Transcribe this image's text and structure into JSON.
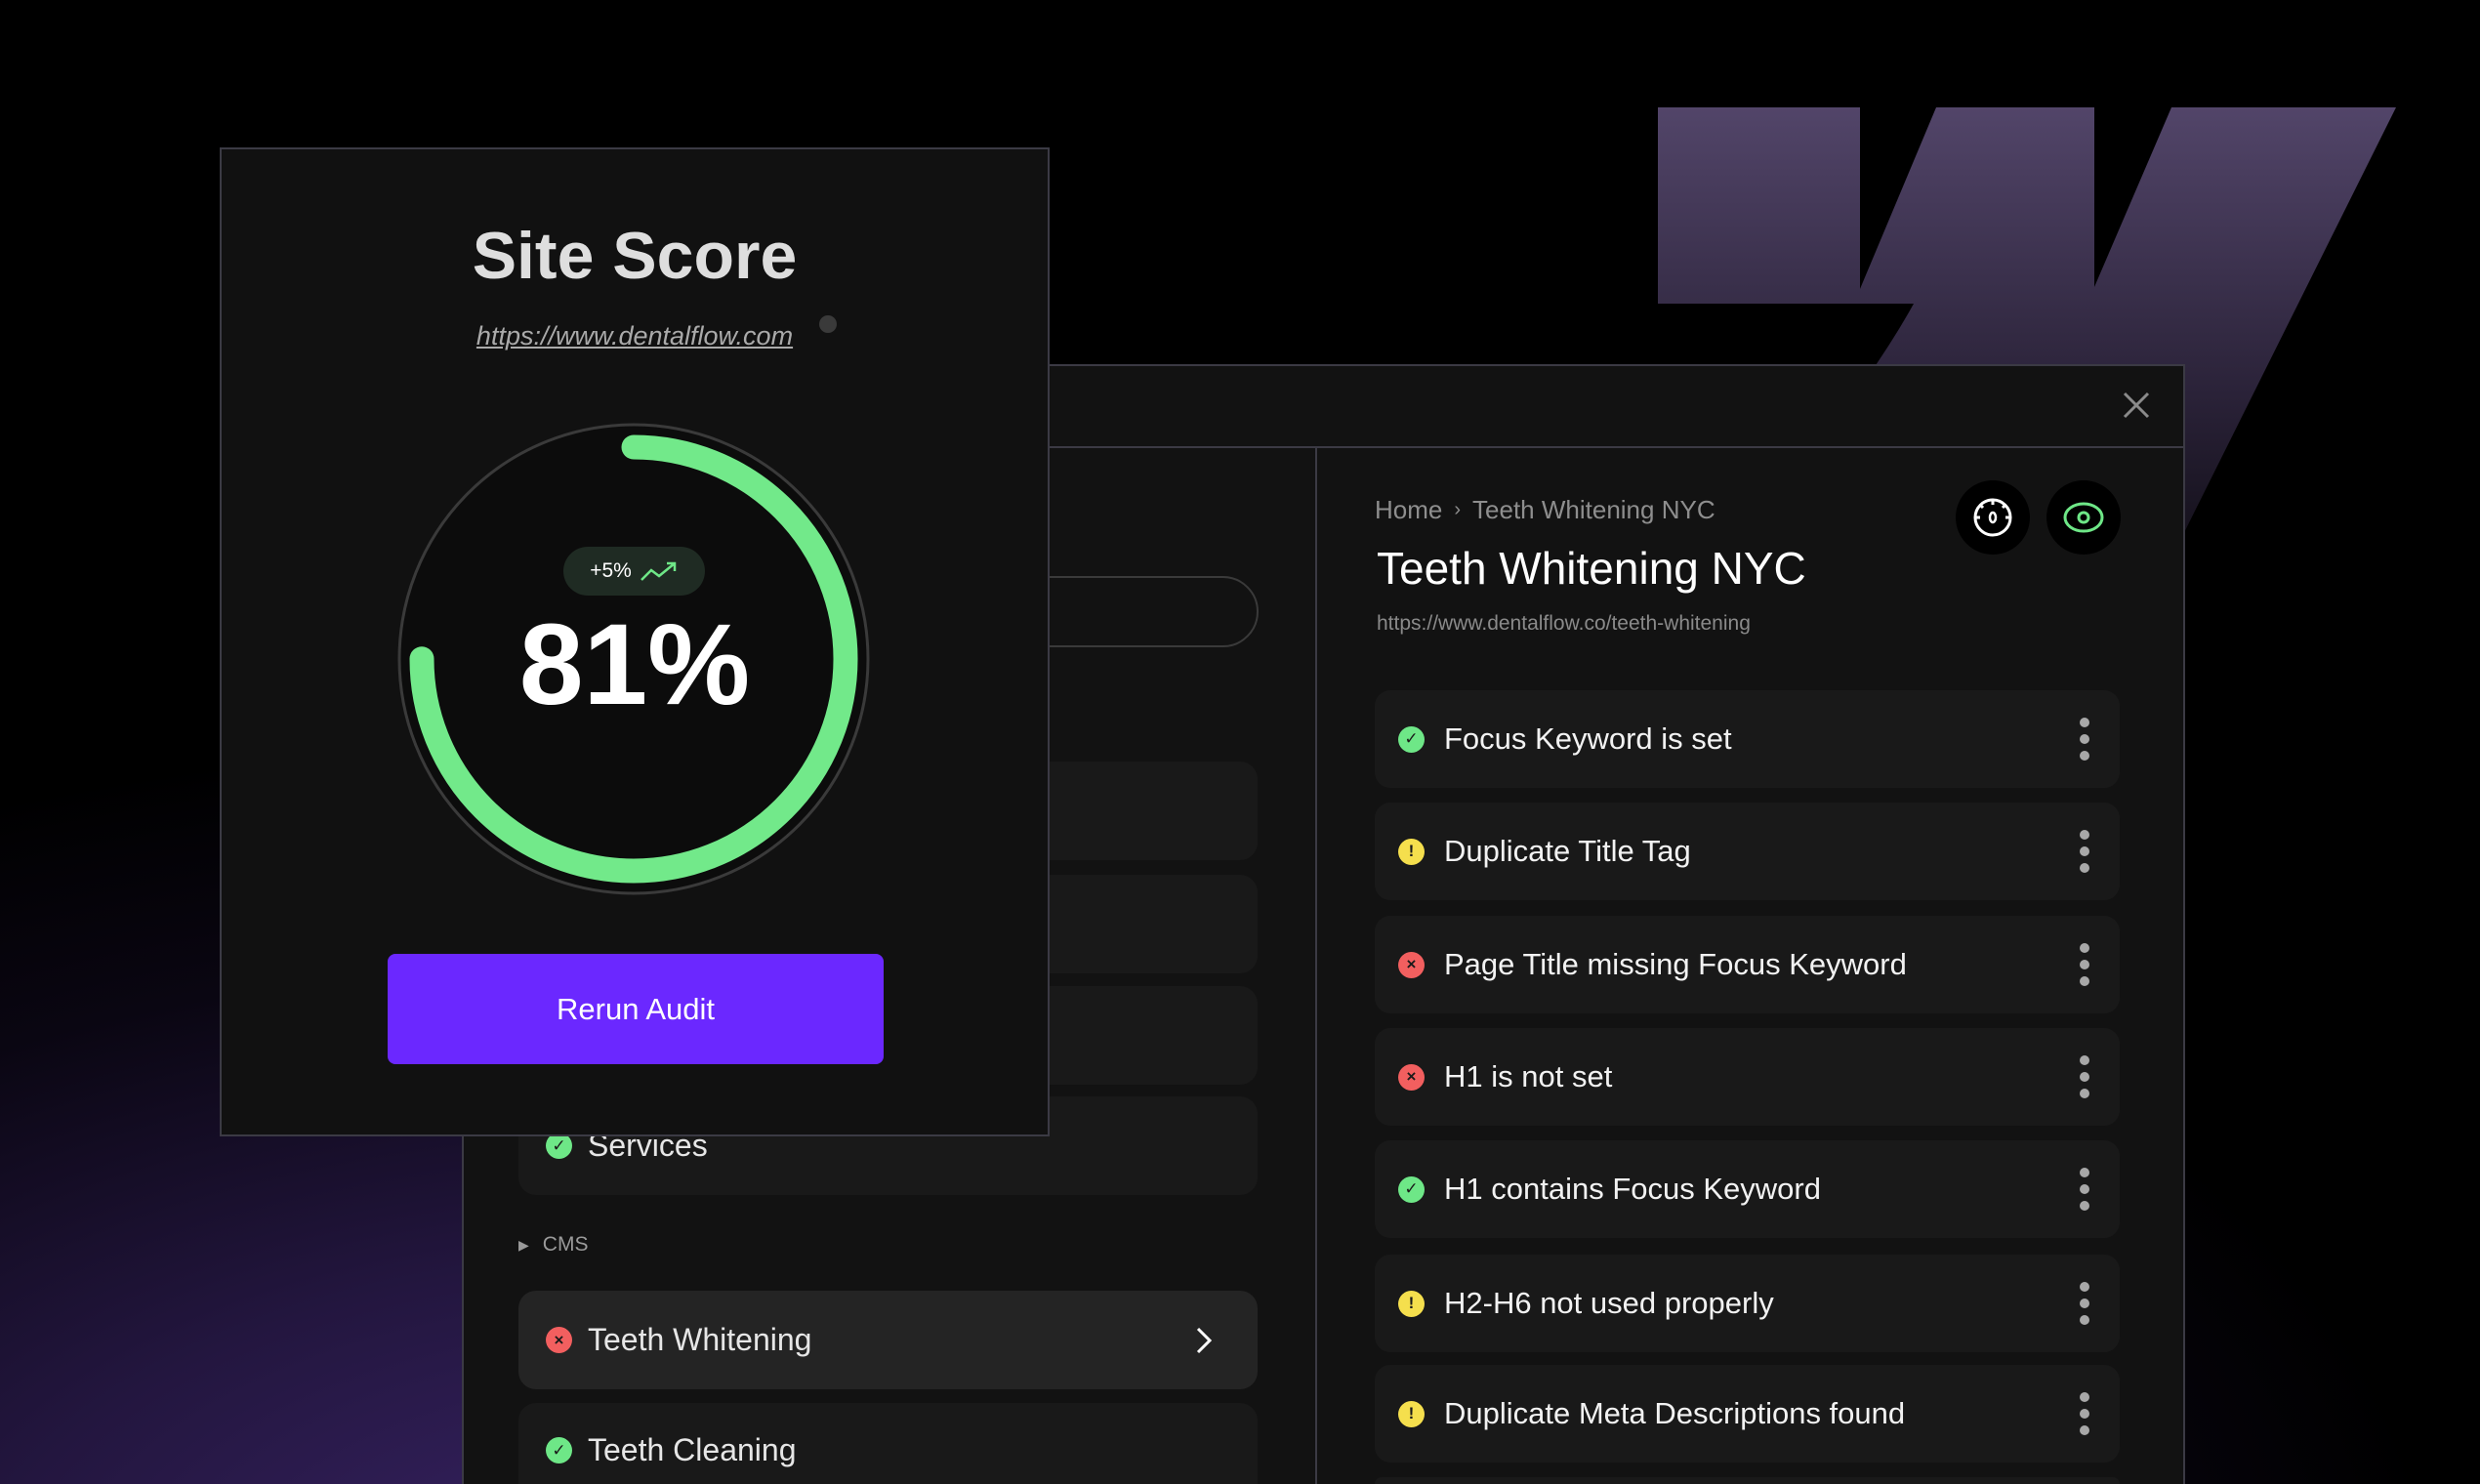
{
  "colors": {
    "accent": "#6b28ff",
    "pass": "#6ee787",
    "warning": "#f5df4d",
    "fail": "#f25f5f",
    "gauge": "#72e98a"
  },
  "logo": {
    "brand": "Webflow"
  },
  "score_card": {
    "title": "Site Score",
    "url": "https://www.dentalflow.com",
    "score_label": "81%",
    "score": 81,
    "gauge_fill_fraction": 0.75,
    "change_label": "+5%",
    "change_icon": "trend-up-icon",
    "button_label": "Rerun Audit"
  },
  "left_panel": {
    "pages": [
      {
        "label": "Services",
        "status": "pass"
      }
    ],
    "section_label": "CMS",
    "cms_items": [
      {
        "label": "Teeth Whitening",
        "status": "fail",
        "active": true
      },
      {
        "label": "Teeth Cleaning",
        "status": "pass",
        "active": false
      }
    ]
  },
  "detail": {
    "breadcrumb": [
      "Home",
      "Teeth Whitening NYC"
    ],
    "title": "Teeth Whitening NYC",
    "url": "https://www.dentalflow.co/teeth-whitening",
    "actions": [
      "speedometer-icon",
      "eye-icon"
    ],
    "issues": [
      {
        "label": "Focus Keyword is set",
        "status": "pass"
      },
      {
        "label": "Duplicate Title Tag",
        "status": "warn"
      },
      {
        "label": "Page Title missing Focus Keyword",
        "status": "fail"
      },
      {
        "label": "H1 is not set",
        "status": "fail"
      },
      {
        "label": "H1 contains Focus Keyword",
        "status": "pass"
      },
      {
        "label": "H2-H6 not used properly",
        "status": "warn"
      },
      {
        "label": "Duplicate Meta Descriptions found",
        "status": "warn"
      }
    ]
  }
}
